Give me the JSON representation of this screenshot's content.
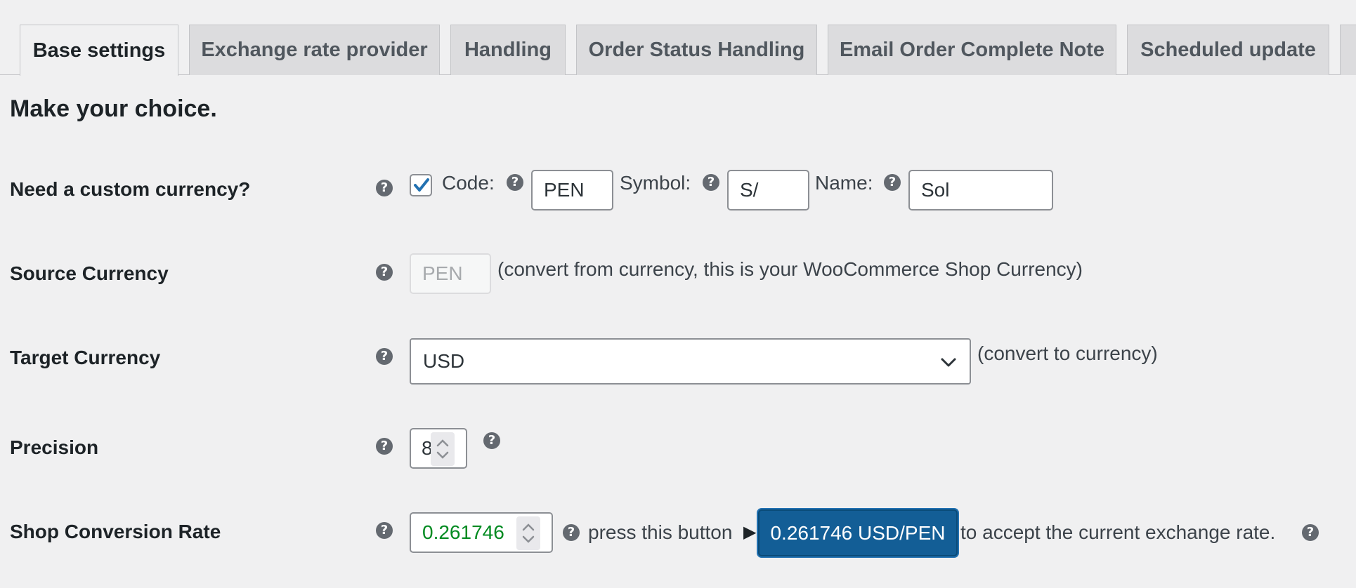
{
  "tabs": [
    {
      "label": "Base settings",
      "active": true
    },
    {
      "label": "Exchange rate provider",
      "active": false
    },
    {
      "label": "Handling",
      "active": false
    },
    {
      "label": "Order Status Handling",
      "active": false
    },
    {
      "label": "Email Order Complete Note",
      "active": false
    },
    {
      "label": "Scheduled update",
      "active": false
    }
  ],
  "heading": "Make your choice.",
  "rows": {
    "custom_currency": {
      "label": "Need a custom currency?",
      "checked": true,
      "code_label": "Code:",
      "code_value": "PEN",
      "symbol_label": "Symbol:",
      "symbol_value": "S/",
      "name_label": "Name:",
      "name_value": "Sol"
    },
    "source_currency": {
      "label": "Source Currency",
      "value": "PEN",
      "note": "(convert from currency, this is your WooCommerce Shop Currency)"
    },
    "target_currency": {
      "label": "Target Currency",
      "selected": "USD",
      "note": "(convert to currency)"
    },
    "precision": {
      "label": "Precision",
      "value": "8"
    },
    "conversion_rate": {
      "label": "Shop Conversion Rate",
      "value": "0.261746",
      "press_text": "press this button",
      "arrow": "▶",
      "button_label": "0.261746 USD/PEN",
      "after_text": "to accept the current exchange rate."
    }
  },
  "help_glyph": "?",
  "colors": {
    "accent": "#135e96",
    "rate_value": "#008a20",
    "background": "#f0f0f1"
  },
  "icons": {
    "help": "question-circle-icon",
    "check": "checkmark-icon",
    "chevron": "chevron-down-icon",
    "spinner": "spin-arrows-icon"
  }
}
